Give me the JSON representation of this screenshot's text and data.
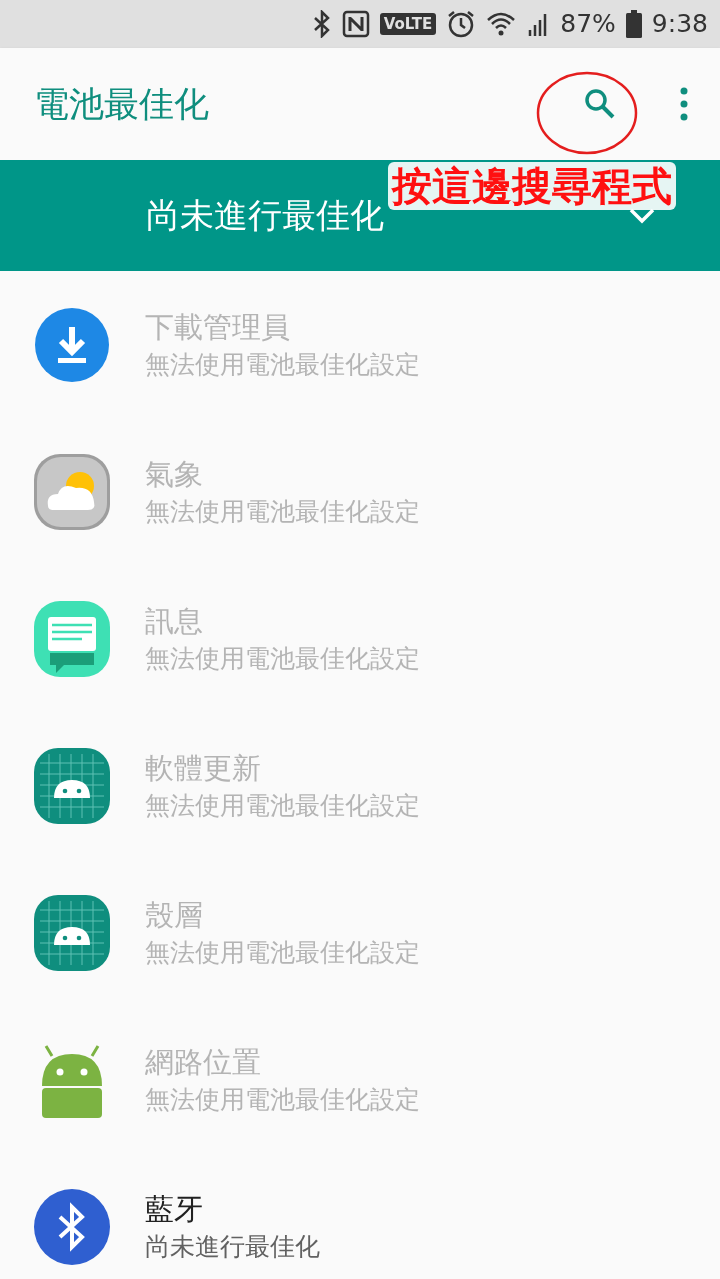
{
  "status_bar": {
    "network": "VoLTE",
    "battery": "87%",
    "time": "9:38"
  },
  "app_bar": {
    "title": "電池最佳化"
  },
  "filter": {
    "label": "尚未進行最佳化",
    "expanded": false
  },
  "annotation": {
    "text": "按這邊搜尋程式"
  },
  "apps": [
    {
      "kind": "download",
      "name": "下載管理員",
      "status": "無法使用電池最佳化設定",
      "disabled": true
    },
    {
      "kind": "weather",
      "name": "氣象",
      "status": "無法使用電池最佳化設定",
      "disabled": true
    },
    {
      "kind": "messages",
      "name": "訊息",
      "status": "無法使用電池最佳化設定",
      "disabled": true
    },
    {
      "kind": "android-grid",
      "name": "軟體更新",
      "status": "無法使用電池最佳化設定",
      "disabled": true
    },
    {
      "kind": "android-grid",
      "name": "殼層",
      "status": "無法使用電池最佳化設定",
      "disabled": true
    },
    {
      "kind": "android",
      "name": "網路位置",
      "status": "無法使用電池最佳化設定",
      "disabled": true
    },
    {
      "kind": "bluetooth",
      "name": "藍牙",
      "status": "尚未進行最佳化",
      "disabled": false
    }
  ]
}
